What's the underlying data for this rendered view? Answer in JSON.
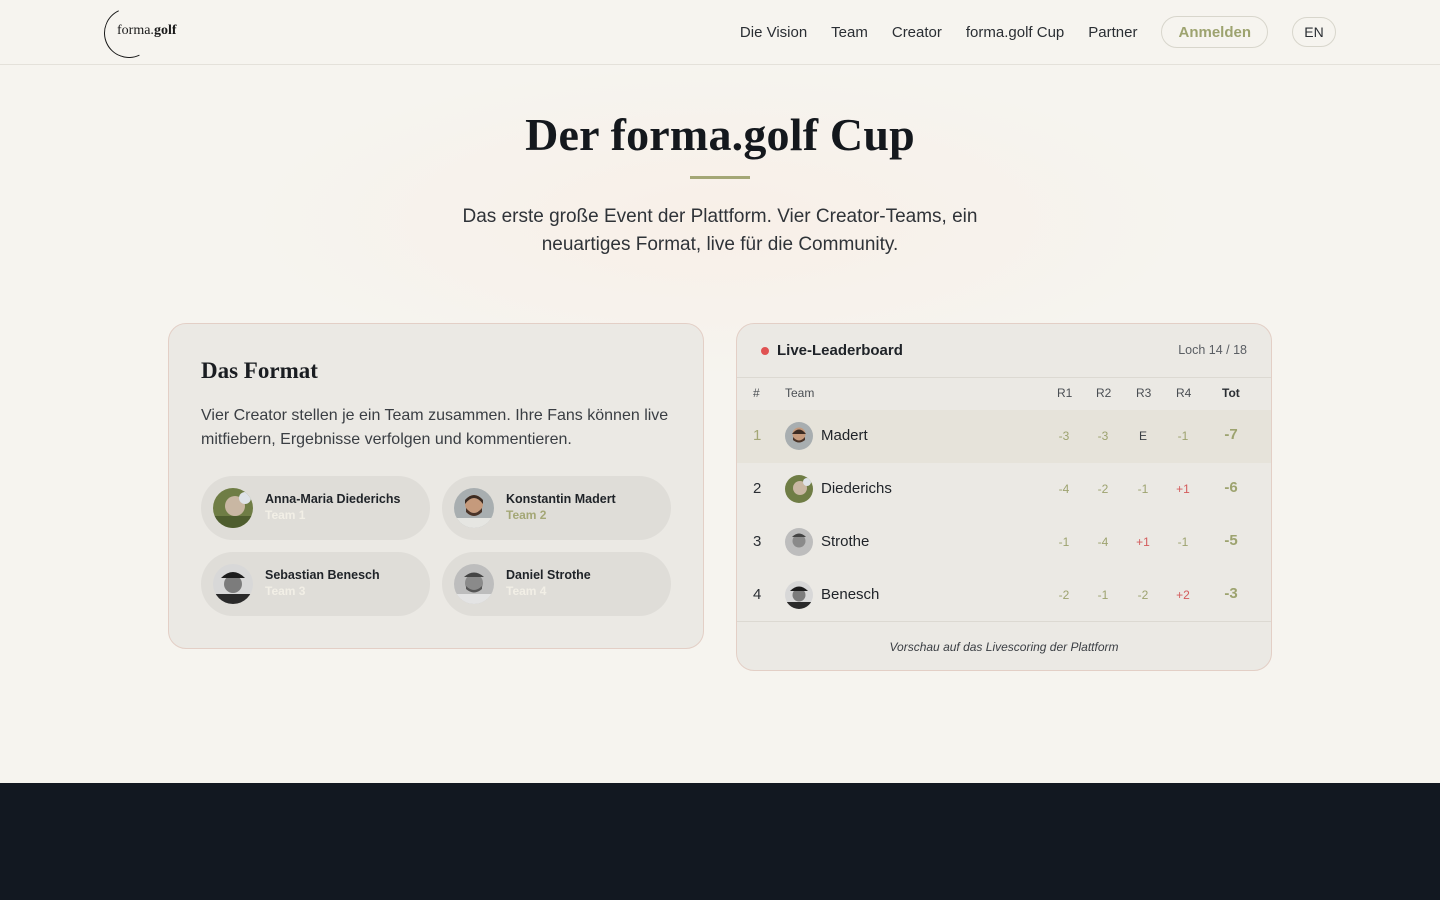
{
  "nav": {
    "logo_prefix": "forma.",
    "logo_suffix": "golf",
    "links": [
      "Die Vision",
      "Team",
      "Creator",
      "forma.golf Cup",
      "Partner"
    ],
    "login_label": "Anmelden",
    "lang_label": "EN"
  },
  "hero": {
    "title": "Der forma.golf Cup",
    "subtitle": "Das erste große Event der Plattform. Vier Creator-Teams, ein neuartiges Format, live für die Community."
  },
  "format": {
    "title": "Das Format",
    "description": "Vier Creator stellen je ein Team zusammen. Ihre Fans können live mitfiebern, Ergebnisse verfolgen und kommentieren.",
    "creators": [
      {
        "name": "Anna-Maria Diederichs",
        "team": "Team 1"
      },
      {
        "name": "Konstantin Madert",
        "team": "Team 2"
      },
      {
        "name": "Sebastian Benesch",
        "team": "Team 3"
      },
      {
        "name": "Daniel Strothe",
        "team": "Team 4"
      }
    ]
  },
  "leaderboard": {
    "title": "Live-Leaderboard",
    "hole": "Loch 14 / 18",
    "columns": {
      "pos": "#",
      "team": "Team",
      "r1": "R1",
      "r2": "R2",
      "r3": "R3",
      "r4": "R4",
      "tot": "Tot"
    },
    "rows": [
      {
        "pos": "1",
        "name": "Madert",
        "r1": "-3",
        "r2": "-3",
        "r3": "E",
        "r4": "-1",
        "tot": "-7"
      },
      {
        "pos": "2",
        "name": "Diederichs",
        "r1": "-4",
        "r2": "-2",
        "r3": "-1",
        "r4": "+1",
        "tot": "-6"
      },
      {
        "pos": "3",
        "name": "Strothe",
        "r1": "-1",
        "r2": "-4",
        "r3": "+1",
        "r4": "-1",
        "tot": "-5"
      },
      {
        "pos": "4",
        "name": "Benesch",
        "r1": "-2",
        "r2": "-1",
        "r3": "-2",
        "r4": "+2",
        "tot": "-3"
      }
    ],
    "footnote": "Vorschau auf das Livescoring der Plattform"
  },
  "colors": {
    "accent": "#9da36f",
    "live": "#e05252",
    "positive_score": "#d35c5c",
    "footer_band": "#121821"
  }
}
